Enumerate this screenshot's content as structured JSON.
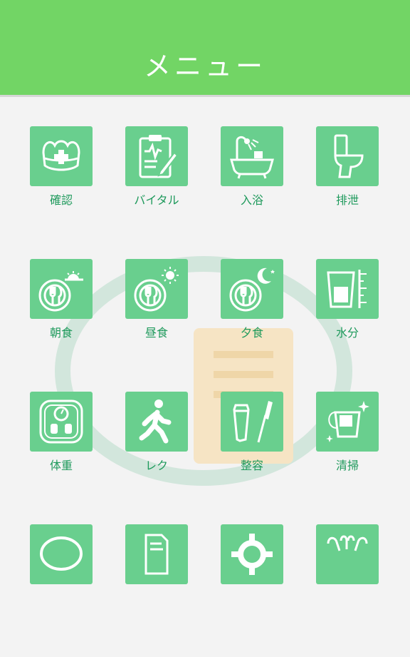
{
  "header": {
    "title": "メニュー"
  },
  "menu": {
    "items": [
      {
        "label": "確認",
        "icon": "nurse-cap-icon"
      },
      {
        "label": "バイタル",
        "icon": "vital-clipboard-icon"
      },
      {
        "label": "入浴",
        "icon": "bathtub-icon"
      },
      {
        "label": "排泄",
        "icon": "toilet-icon"
      },
      {
        "label": "朝食",
        "icon": "breakfast-icon"
      },
      {
        "label": "昼食",
        "icon": "lunch-icon"
      },
      {
        "label": "夕食",
        "icon": "dinner-icon"
      },
      {
        "label": "水分",
        "icon": "water-glass-icon"
      },
      {
        "label": "体重",
        "icon": "weight-scale-icon"
      },
      {
        "label": "レク",
        "icon": "walking-person-icon"
      },
      {
        "label": "整容",
        "icon": "toothbrush-icon"
      },
      {
        "label": "清掃",
        "icon": "bucket-icon"
      },
      {
        "label": "",
        "icon": "speech-bubble-icon"
      },
      {
        "label": "",
        "icon": "document-icon"
      },
      {
        "label": "",
        "icon": "gear-icon"
      },
      {
        "label": "",
        "icon": "hands-icon"
      }
    ]
  },
  "colors": {
    "header": "#72d565",
    "tile": "#69cf8e",
    "label": "#1f9a5c",
    "background": "#f3f3f3"
  }
}
